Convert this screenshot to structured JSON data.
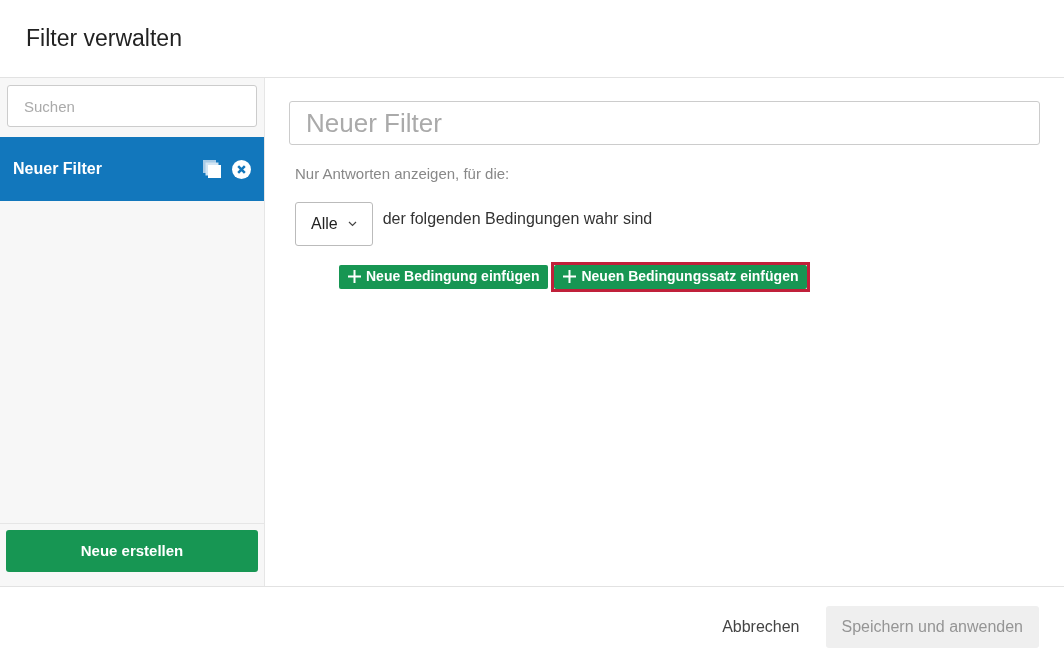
{
  "dialog": {
    "title": "Filter verwalten"
  },
  "sidebar": {
    "search": {
      "placeholder": "Suchen"
    },
    "items": [
      {
        "label": "Neuer Filter",
        "selected": true
      }
    ],
    "create_button": "Neue erstellen"
  },
  "editor": {
    "name_field": {
      "placeholder": "Neuer Filter"
    },
    "intro": "Nur Antworten anzeigen, für die:",
    "match_select": {
      "value": "Alle"
    },
    "match_text": "der folgenden Bedingungen wahr sind",
    "actions": [
      {
        "label": "Neue Bedingung einfügen",
        "highlighted": false
      },
      {
        "label": "Neuen Bedingungssatz einfügen",
        "highlighted": true
      }
    ]
  },
  "footer": {
    "cancel": "Abbrechen",
    "save": {
      "label": "Speichern und anwenden",
      "disabled": true
    }
  }
}
